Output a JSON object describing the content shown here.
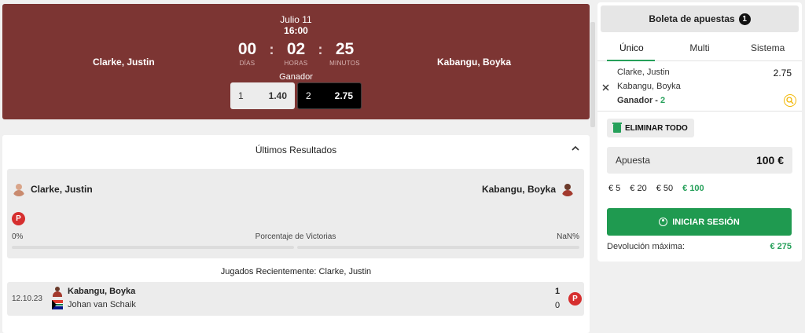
{
  "match": {
    "date": "Julio 11",
    "time": "16:00",
    "countdown": [
      {
        "value": "00",
        "label": "DÍAS"
      },
      {
        "value": "02",
        "label": "HORAS"
      },
      {
        "value": "25",
        "label": "MINUTOS"
      }
    ],
    "separator": ":",
    "player1": "Clarke, Justin",
    "player2": "Kabangu, Boyka",
    "market": "Ganador",
    "odds": [
      {
        "label": "1",
        "value": "1.40"
      },
      {
        "label": "2",
        "value": "2.75"
      }
    ]
  },
  "results": {
    "title": "Últimos Resultados",
    "player1": "Clarke, Justin",
    "player2": "Kabangu, Boyka",
    "form_badge": "P",
    "pct_left": "0%",
    "pct_label": "Porcentaje de Victorias",
    "pct_right": "NaN%",
    "recent_title": "Jugados Recientemente: Clarke, Justin",
    "recent": {
      "date": "12.10.23",
      "team1": "Kabangu, Boyka",
      "team2": "Johan van Schaik",
      "score1": "1",
      "score2": "0",
      "badge": "P"
    }
  },
  "betslip": {
    "title": "Boleta de apuestas",
    "count": "1",
    "tabs": [
      "Único",
      "Multi",
      "Sistema"
    ],
    "selection": {
      "line1": "Clarke, Justin",
      "line2": "Kabangu, Boyka",
      "market": "Ganador - ",
      "pick": "2",
      "odd": "2.75"
    },
    "delete_all": "ELIMINAR TODO",
    "stake_label": "Apuesta",
    "stake_value": "100 €",
    "quick": [
      "€ 5",
      "€ 20",
      "€ 50",
      "€ 100"
    ],
    "login": "INICIAR SESIÓN",
    "max_return_label": "Devolución máxima:",
    "max_return_value": "€ 275"
  },
  "icons": {
    "close": "close-icon",
    "search": "search-icon",
    "trash": "trash-icon",
    "user": "user-icon",
    "chevron": "chevron-up-icon"
  },
  "colors": {
    "header_bg": "#7c3533",
    "accent_green": "#26a05a",
    "badge_red": "#d62f2f"
  }
}
